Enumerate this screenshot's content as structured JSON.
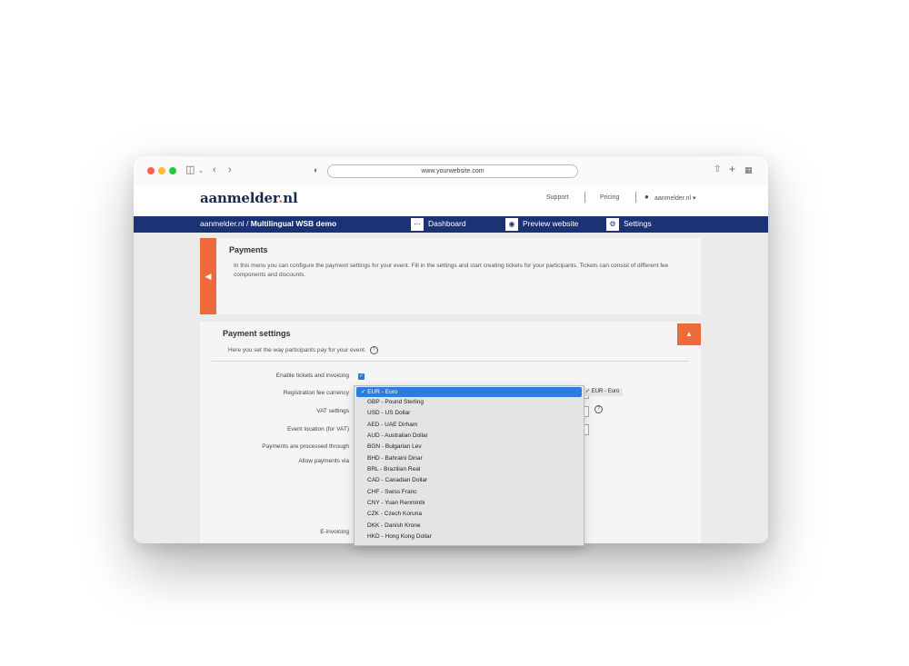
{
  "browser": {
    "url": "www.yourwebsite.com"
  },
  "header": {
    "logo_main": "aanmelder",
    "logo_dot": ".",
    "logo_tld": "nl",
    "support": "Support",
    "pricing": "Pricing",
    "user": "aanmelder.nl ▾"
  },
  "nav": {
    "breadcrumb_root": "aanmelder.nl / ",
    "breadcrumb_event": "Multilingual WSB demo",
    "dashboard": "Dashboard",
    "preview": "Preview website",
    "settings": "Settings"
  },
  "payments": {
    "title": "Payments",
    "description": "In this menu you can configure the payment settings for your event. Fill in the settings and start creating tickets for your participants. Tickets can consist of different fee components and discounts."
  },
  "payment_settings": {
    "title": "Payment settings",
    "intro": "Here you set the way participants pay for your event.",
    "fields": [
      "Enable tickets and invoicing",
      "Registration fee currency",
      "VAT settings",
      "Event location (for VAT)",
      "Payments are processed through",
      "Allow payments via",
      "E-invoicing"
    ],
    "currency_selected": "EUR - Euro"
  },
  "currency_options": [
    "✓ EUR - Euro",
    "GBP - Pound Sterling",
    "USD - US Dollar",
    "AED - UAE Dirham",
    "AUD - Australian Dollar",
    "BGN - Bulgarian Lev",
    "BHD - Bahraini Dinar",
    "BRL - Brazilian Real",
    "CAD - Canadian Dollar",
    "CHF - Swiss Franc",
    "CNY - Yuan Renminbi",
    "CZK - Czech Koruna",
    "DKK - Danish Krone",
    "HKD - Hong Kong Dollar"
  ]
}
